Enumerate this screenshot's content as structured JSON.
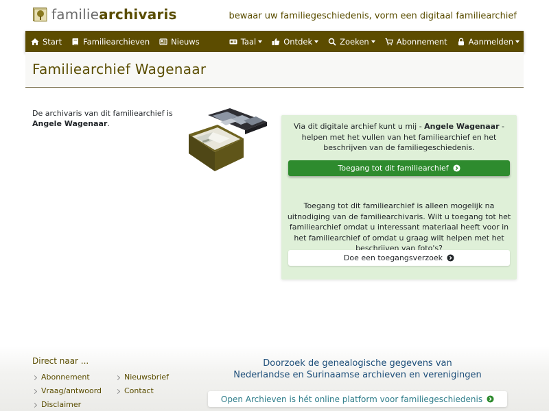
{
  "header": {
    "brand_light": "familie",
    "brand_bold": "archivaris",
    "tagline": "bewaar uw familiegeschiedenis, vorm een digitaal familiearchief"
  },
  "nav": {
    "left": [
      {
        "label": "Start",
        "icon": "home-icon"
      },
      {
        "label": "Familiearchieven",
        "icon": "book-icon"
      },
      {
        "label": "Nieuws",
        "icon": "newspaper-icon"
      }
    ],
    "right": [
      {
        "label": "Taal",
        "icon": "language-icon",
        "dropdown": true
      },
      {
        "label": "Ontdek",
        "icon": "thumbs-up-icon",
        "dropdown": true
      },
      {
        "label": "Zoeken",
        "icon": "search-icon",
        "dropdown": true
      },
      {
        "label": "Abonnement",
        "icon": "cart-icon",
        "dropdown": false
      },
      {
        "label": "Aanmelden",
        "icon": "lock-icon",
        "dropdown": true
      }
    ]
  },
  "page": {
    "title": "Familiearchief Wagenaar",
    "intro_text": "De archivaris van dit familiearchief is",
    "archivist_name": "Angele Wagenaar",
    "intro_period": "."
  },
  "panel": {
    "p1_pre": "Via dit digitale archief kunt u mij - ",
    "p1_name": "Angele Wagenaar",
    "p1_post": " - helpen met het vullen van het familiearchief en het beschrijven van de familiegeschiedenis.",
    "access_button": "Toegang tot dit familiearchief",
    "p2": "Toegang tot dit familiearchief is alleen mogelijk na uitnodiging van de familiearchivaris. Wilt u toegang tot het familiearchief omdat u interessant materiaal heeft voor in het familiearchief of omdat u graag wilt helpen met het beschrijven van foto's?",
    "request_button": "Doe een toegangsverzoek"
  },
  "footer": {
    "heading": "Direct naar ...",
    "links_col1": [
      "Abonnement",
      "Vraag/antwoord",
      "Disclaimer"
    ],
    "links_col2": [
      "Nieuwsbrief",
      "Contact"
    ],
    "search_line1": "Doorzoek de genealogische gegevens van",
    "search_line2": "Nederlandse en Surinaamse archieven en verenigingen",
    "oa_button": "Open Archieven is hét online platform voor familiegeschiedenis"
  },
  "colors": {
    "navbar": "#5c4c00",
    "accent_text": "#5a4d00",
    "panel_bg": "#dff0d8",
    "primary_button": "#2e8b2e"
  }
}
